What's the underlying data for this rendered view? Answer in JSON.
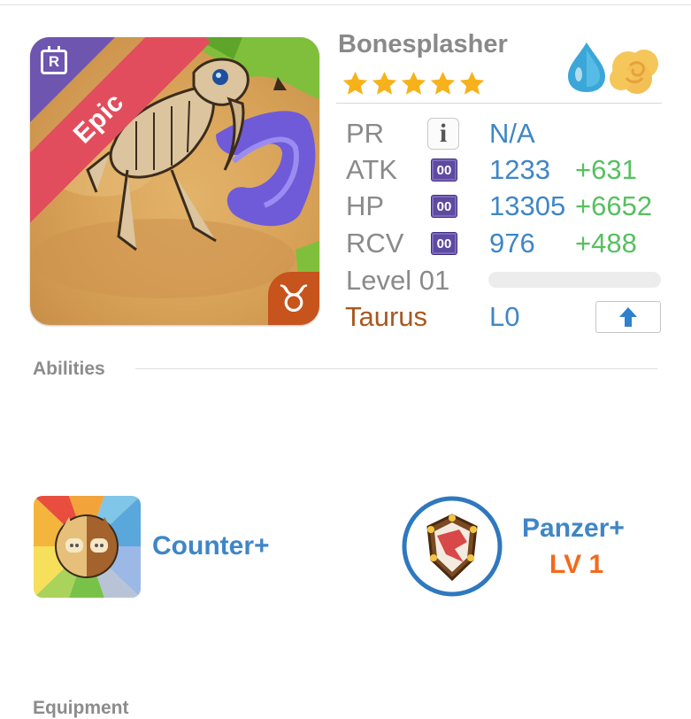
{
  "monster": {
    "name": "Bonesplasher",
    "rarity": "Epic",
    "rarity_badge": "R",
    "stars": 5,
    "elements": [
      "water-drop-icon",
      "cloud-swirl-icon"
    ],
    "zodiac_symbol": "♉"
  },
  "stats": {
    "pr": {
      "label": "PR",
      "value": "N/A"
    },
    "atk": {
      "label": "ATK",
      "badge": "00",
      "value": "1233",
      "bonus": "+631"
    },
    "hp": {
      "label": "HP",
      "badge": "00",
      "value": "13305",
      "bonus": "+6652"
    },
    "rcv": {
      "label": "RCV",
      "badge": "00",
      "value": "976",
      "bonus": "+488"
    },
    "level": {
      "label": "Level 01",
      "progress": 0
    }
  },
  "zodiac": {
    "name": "Taurus",
    "level": "L0"
  },
  "sections": {
    "abilities": "Abilities",
    "equipment": "Equipment"
  },
  "abilities": [
    {
      "name": "Counter+",
      "icon": "counter-icon"
    },
    {
      "name": "Panzer+",
      "level": "LV 1",
      "icon": "panzer-shield-icon"
    }
  ],
  "colors": {
    "accent_blue": "#3f86c6",
    "bonus_green": "#56c060",
    "zodiac_brown": "#a8581f",
    "level_orange": "#f26a1b",
    "epic_red": "#e24d5d",
    "star_gold": "#f7b21b"
  }
}
